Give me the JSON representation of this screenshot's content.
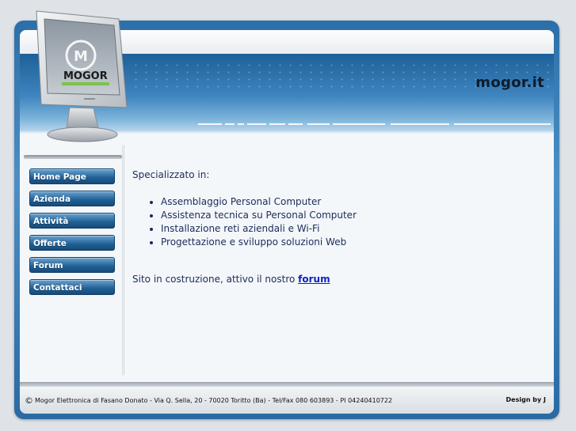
{
  "header": {
    "site_title": "mogor.it",
    "logo_text": "MOGOR"
  },
  "nav": {
    "items": [
      {
        "label": "Home Page"
      },
      {
        "label": "Azienda"
      },
      {
        "label": "Attività"
      },
      {
        "label": "Offerte"
      },
      {
        "label": "Forum"
      },
      {
        "label": "Contattaci"
      }
    ]
  },
  "main": {
    "intro": "Specializzato in:",
    "services": [
      "Assemblaggio Personal Computer",
      "Assistenza tecnica su Personal Computer",
      "Installazione reti aziendali e Wi-Fi",
      "Progettazione e sviluppo soluzioni Web"
    ],
    "note_prefix": "Sito in costruzione, attivo il nostro ",
    "note_link": "forum"
  },
  "footer": {
    "copyright_symbol": "©",
    "copyright_text": "Mogor Elettronica di Fasano Donato - Via Q. Sella, 20 - 70020 Toritto (Ba) - Tel/Fax 080 603893 - PI 04240410722",
    "design_credit": "Design by J"
  },
  "icons": {
    "logo": "monitor-logo-icon"
  },
  "colors": {
    "nav_button": "#1f5f95",
    "header_blue": "#3f85bf",
    "link": "#0b23c4",
    "text": "#1c2b5a"
  }
}
